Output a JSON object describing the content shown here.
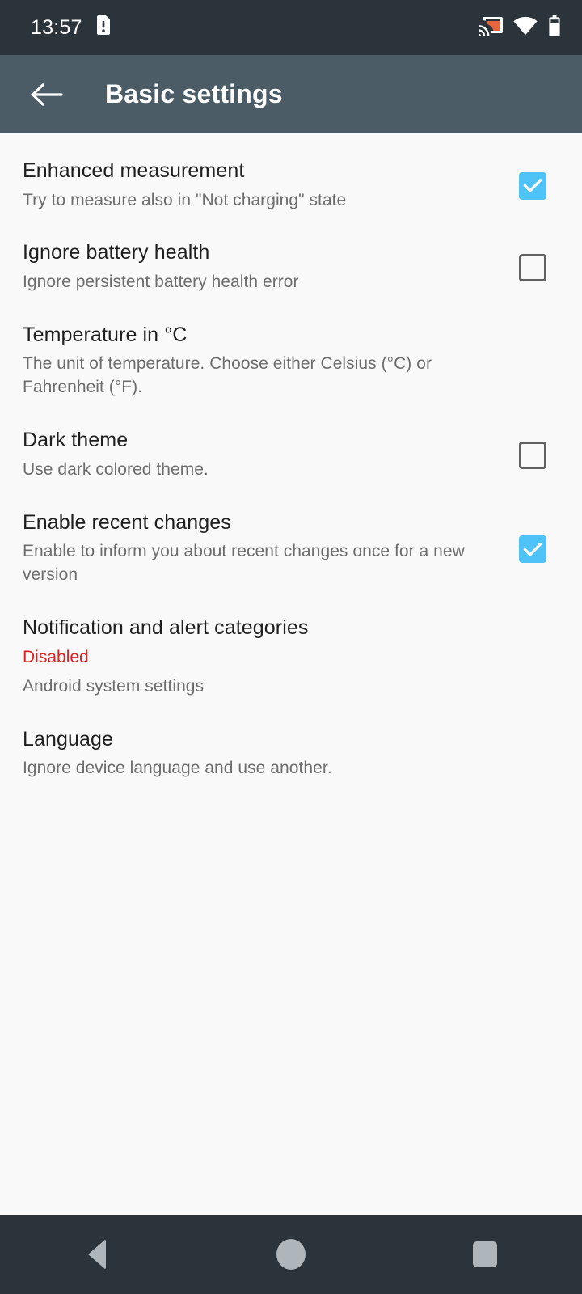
{
  "status_bar": {
    "time": "13:57",
    "icons": [
      "sdcard-alert-icon",
      "cast-icon",
      "wifi-icon",
      "battery-icon"
    ],
    "background_color": "#2b343b",
    "cast_icon_color": "#e8643c"
  },
  "toolbar": {
    "back_label": "back-arrow",
    "title": "Basic settings",
    "background_color": "#4b5c66",
    "text_color": "#ffffff"
  },
  "colors": {
    "checkbox_checked": "#4fc3f7",
    "checkbox_unchecked_border": "#616161",
    "status_disabled": "#e02020",
    "page_background": "#f9f9f9",
    "title_text": "#1f1f1f",
    "summary_text": "#6d6d6d",
    "nav_icon": "#aeb6bb"
  },
  "preferences": [
    {
      "title": "Enhanced measurement",
      "summary": "Try to measure also in \"Not charging\" state",
      "widget": "checkbox",
      "checked": true
    },
    {
      "title": "Ignore battery health",
      "summary": "Ignore persistent battery health error",
      "widget": "checkbox",
      "checked": false
    },
    {
      "title": "Temperature in °C",
      "summary": "The unit of temperature. Choose either Celsius (°C) or Fahrenheit (°F).",
      "widget": "none",
      "checked": null
    },
    {
      "title": "Dark theme",
      "summary": "Use dark colored theme.",
      "widget": "checkbox",
      "checked": false
    },
    {
      "title": "Enable recent changes",
      "summary": "Enable to inform you about recent changes once for a new version",
      "widget": "checkbox",
      "checked": true
    },
    {
      "title": "Notification and alert categories",
      "status": "Disabled",
      "summary": "Android system settings",
      "widget": "none",
      "checked": null
    },
    {
      "title": "Language",
      "summary": "Ignore device language and use another.",
      "widget": "none",
      "checked": null
    }
  ],
  "nav_bar": {
    "back": "back-triangle-icon",
    "home": "home-circle-icon",
    "recents": "recents-square-icon"
  }
}
